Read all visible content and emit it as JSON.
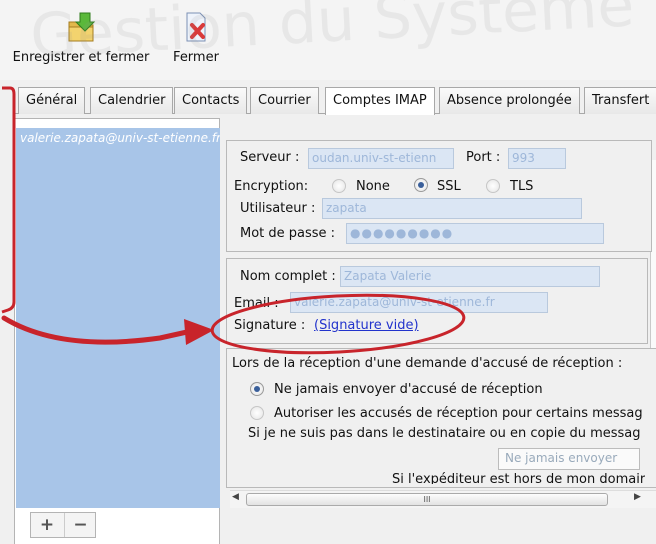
{
  "watermark": "Gestion du Système",
  "toolbar": {
    "save_label": "Enregistrer et fermer",
    "close_label": "Fermer"
  },
  "tabs": [
    {
      "label": "Général"
    },
    {
      "label": "Calendrier"
    },
    {
      "label": "Contacts"
    },
    {
      "label": "Courrier"
    },
    {
      "label": "Comptes IMAP"
    },
    {
      "label": "Absence prolongée"
    },
    {
      "label": "Transfert"
    }
  ],
  "accounts": {
    "items": [
      {
        "label": "valerie.zapata@univ-st-etienne.fr"
      }
    ],
    "add_label": "+",
    "remove_label": "−"
  },
  "server": {
    "server_label": "Serveur :",
    "server_value": "oudan.univ-st-etienn",
    "port_label": "Port :",
    "port_value": "993",
    "encryption_label": "Encryption:",
    "enc_none": "None",
    "enc_ssl": "SSL",
    "enc_tls": "TLS",
    "enc_selected": "SSL",
    "user_label": "Utilisateur :",
    "user_value": "zapata",
    "password_label": "Mot de passe :",
    "password_value": "●●●●●●●●●"
  },
  "identity": {
    "fullname_label": "Nom complet :",
    "fullname_value": "Zapata Valerie",
    "email_label": "Email :",
    "email_value": "valerie.zapata@univ-st-etienne.fr",
    "signature_label": "Signature :",
    "signature_link": "(Signature vide)"
  },
  "receipts": {
    "heading": "Lors de la réception d'une demande d'accusé de réception :",
    "option_never": "Ne jamais envoyer d'accusé de réception",
    "option_allow": "Autoriser les accusés de réception pour certains messag",
    "option_allow_sub": "Si je ne suis pas dans le destinataire ou en copie du messag",
    "combo_value": "Ne jamais envoyer",
    "option_cutoff": "Si l'expéditeur est hors de mon domair",
    "selected": "never"
  },
  "scrollbar": {
    "grip": "III"
  },
  "annotation_color": "#c8242b"
}
